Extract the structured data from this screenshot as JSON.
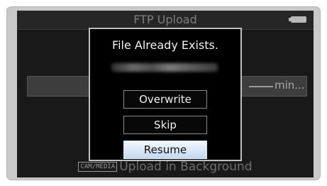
{
  "screen": {
    "title": "FTP Upload",
    "battery_icon": "battery-icon",
    "progress_time_dots": "::::",
    "progress_time_unit": "min...",
    "mode_badge": "CAM/MEDIA",
    "background_label": "Upload in Background"
  },
  "dialog": {
    "title": "File Already Exists.",
    "filename": "",
    "buttons": {
      "overwrite": "Overwrite",
      "skip": "Skip",
      "resume": "Resume"
    },
    "selected": "Resume"
  },
  "colors": {
    "screen_background": "#191919",
    "dialog_background": "#000000",
    "dialog_border": "#bfbfbf",
    "selected_button": "#cfe0f3"
  }
}
